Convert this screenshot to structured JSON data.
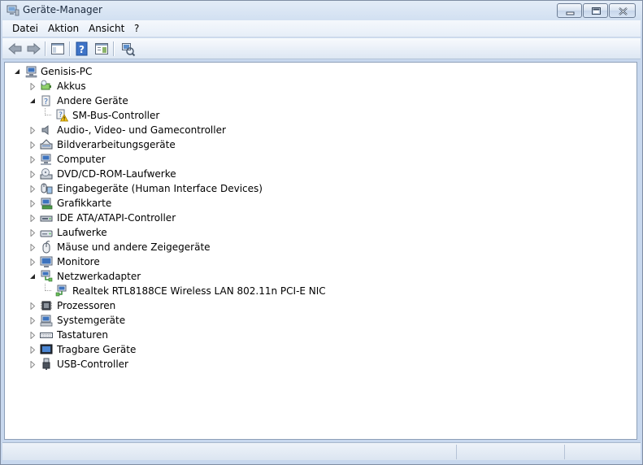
{
  "window": {
    "title": "Geräte-Manager"
  },
  "menu": {
    "items": [
      {
        "label": "Datei"
      },
      {
        "label": "Aktion"
      },
      {
        "label": "Ansicht"
      },
      {
        "label": "?"
      }
    ]
  },
  "toolbar": {
    "buttons": [
      "back-arrow-icon",
      "forward-arrow-icon",
      "show-hide-console-tree-icon",
      "help-icon",
      "properties-icon",
      "scan-hardware-icon"
    ]
  },
  "tree": {
    "root": {
      "label": "Genisis-PC",
      "expanded": true
    },
    "nodes": [
      {
        "label": "Akkus",
        "icon": "battery-icon",
        "expanded": false
      },
      {
        "label": "Andere Geräte",
        "icon": "unknown-device-icon",
        "expanded": true
      },
      {
        "label": "SM-Bus-Controller",
        "icon": "warning-device-icon",
        "child": true
      },
      {
        "label": "Audio-, Video- und Gamecontroller",
        "icon": "speaker-icon",
        "expanded": false
      },
      {
        "label": "Bildverarbeitungsgeräte",
        "icon": "scanner-icon",
        "expanded": false
      },
      {
        "label": "Computer",
        "icon": "computer-icon",
        "expanded": false
      },
      {
        "label": "DVD/CD-ROM-Laufwerke",
        "icon": "optical-drive-icon",
        "expanded": false
      },
      {
        "label": "Eingabegeräte (Human Interface Devices)",
        "icon": "hid-icon",
        "expanded": false
      },
      {
        "label": "Grafikkarte",
        "icon": "display-adapter-icon",
        "expanded": false
      },
      {
        "label": "IDE ATA/ATAPI-Controller",
        "icon": "ide-controller-icon",
        "expanded": false
      },
      {
        "label": "Laufwerke",
        "icon": "disk-drive-icon",
        "expanded": false
      },
      {
        "label": "Mäuse und andere Zeigegeräte",
        "icon": "mouse-icon",
        "expanded": false
      },
      {
        "label": "Monitore",
        "icon": "monitor-icon",
        "expanded": false
      },
      {
        "label": "Netzwerkadapter",
        "icon": "network-adapter-icon",
        "expanded": true
      },
      {
        "label": "Realtek RTL8188CE Wireless LAN 802.11n PCI-E NIC",
        "icon": "network-card-icon",
        "child": true
      },
      {
        "label": "Prozessoren",
        "icon": "processor-icon",
        "expanded": false
      },
      {
        "label": "Systemgeräte",
        "icon": "system-device-icon",
        "expanded": false
      },
      {
        "label": "Tastaturen",
        "icon": "keyboard-icon",
        "expanded": false
      },
      {
        "label": "Tragbare Geräte",
        "icon": "portable-device-icon",
        "expanded": false
      },
      {
        "label": "USB-Controller",
        "icon": "usb-icon",
        "expanded": false
      }
    ]
  },
  "colors": {
    "title_text": "#1c2a3e",
    "tree_background": "#ffffff",
    "window_frame": "#c8d8ee"
  }
}
